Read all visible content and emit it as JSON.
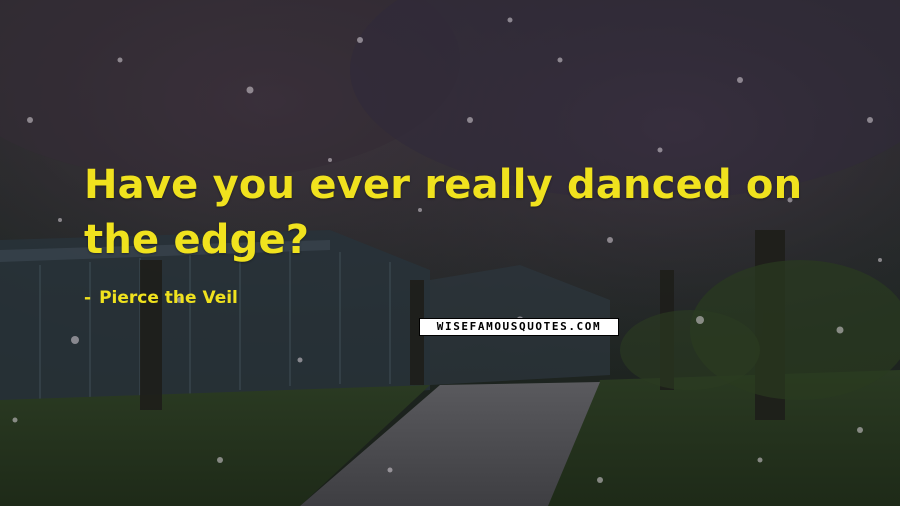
{
  "quote": {
    "text": "Have you ever really danced on the edge?",
    "author": "Pierce the Veil",
    "author_prefix": "-"
  },
  "watermark": {
    "text": "WISEFAMOUSQUOTES.COM"
  },
  "colors": {
    "text": "#f0e21e",
    "watermark_bg": "#ffffff",
    "watermark_text": "#000000"
  }
}
